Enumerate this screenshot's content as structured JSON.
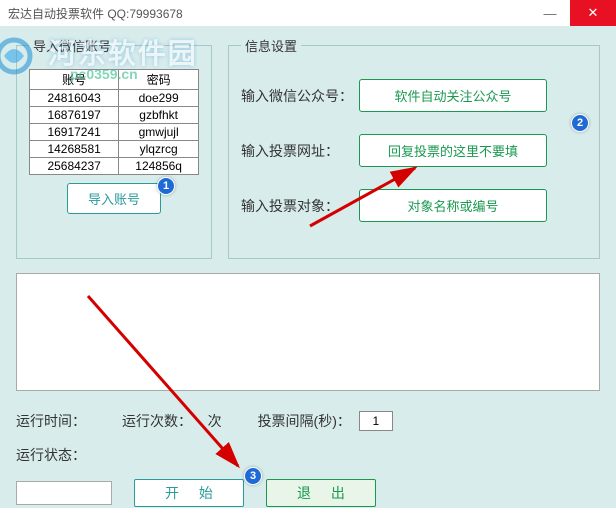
{
  "window": {
    "title": "宏达自动投票软件   QQ:79993678"
  },
  "watermark": {
    "text": "河东软件园",
    "sub": "pc0359.cn"
  },
  "import_panel": {
    "legend": "导入微信账号",
    "headers": [
      "账号",
      "密码"
    ],
    "rows": [
      [
        "24816043",
        "doe299"
      ],
      [
        "16876197",
        "gzbfhkt"
      ],
      [
        "16917241",
        "gmwjujl"
      ],
      [
        "14268581",
        "ylqzrcg"
      ],
      [
        "25684237",
        "124856q"
      ]
    ],
    "import_button": "导入账号"
  },
  "info_panel": {
    "legend": "信息设置",
    "rows": [
      {
        "label": "输入微信公众号：",
        "button": "软件自动关注公众号"
      },
      {
        "label": "输入投票网址：",
        "button": "回复投票的这里不要填"
      },
      {
        "label": "输入投票对象：",
        "button": "对象名称或编号"
      }
    ]
  },
  "stats": {
    "runtime_label": "运行时间：",
    "runcount_label": "运行次数：",
    "runcount_unit": "次",
    "interval_label": "投票间隔(秒)：",
    "interval_value": "1"
  },
  "status": {
    "label": "运行状态："
  },
  "actions": {
    "start": "开 始",
    "exit": "退 出"
  },
  "badges": {
    "b1": "1",
    "b2": "2",
    "b3": "3"
  }
}
